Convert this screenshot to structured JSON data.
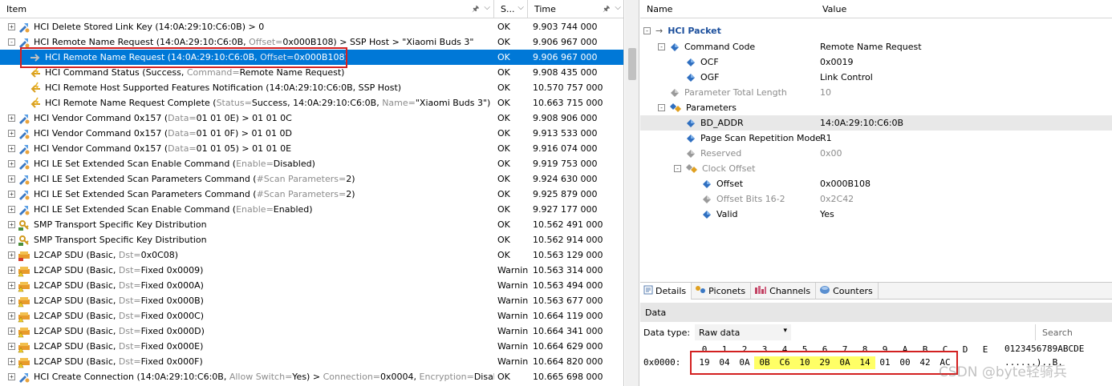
{
  "columns": {
    "item": "Item",
    "status": "S...",
    "time": "Time"
  },
  "rows": [
    {
      "exp": "+",
      "icon": "pkt",
      "text": "HCI Delete Stored Link Key (14:0A:29:10:C6:0B) > 0",
      "status": "OK",
      "time": "9.903 744 000"
    },
    {
      "exp": "-",
      "icon": "pkt",
      "text_a": "HCI Remote Name Request (14:0A:29:10:C6:0B, ",
      "text_g": "Offset=",
      "text_b": "0x000B108) > SSP Host > \"Xiaomi Buds 3\"",
      "status": "OK",
      "time": "9.906 967 000"
    },
    {
      "indent": true,
      "selected": true,
      "icon": "arrow-right",
      "text_a": "HCI Remote Name Request (14:0A:29:10:C6:0B, ",
      "text_g": "Offset=",
      "text_b": "0x000B108)",
      "status": "OK",
      "time": "9.906 967 000"
    },
    {
      "indent": true,
      "icon": "arrow-left-bolt",
      "text_a": "HCI Command Status (Success, ",
      "text_g": "Command=",
      "text_b": "Remote Name Request)",
      "status": "OK",
      "time": "9.908 435 000"
    },
    {
      "indent": true,
      "icon": "arrow-left-bolt",
      "text": "HCI Remote Host Supported Features Notification (14:0A:29:10:C6:0B, SSP Host)",
      "status": "OK",
      "time": "10.570 757 000"
    },
    {
      "indent": true,
      "icon": "arrow-left-bolt",
      "text_a": "HCI Remote Name Request Complete (",
      "text_g": "Status=",
      "text_b": "Success, 14:0A:29:10:C6:0B, ",
      "text_g2": "Name=",
      "text_c": "\"Xiaomi Buds 3\")",
      "status": "OK",
      "time": "10.663 715 000"
    },
    {
      "exp": "+",
      "icon": "pkt",
      "text_a": "HCI Vendor Command 0x157 (",
      "text_g": "Data=",
      "text_b": "01 01 0E) > 01 01 0C",
      "status": "OK",
      "time": "9.908 906 000"
    },
    {
      "exp": "+",
      "icon": "pkt",
      "text_a": "HCI Vendor Command 0x157 (",
      "text_g": "Data=",
      "text_b": "01 01 0F) > 01 01 0D",
      "status": "OK",
      "time": "9.913 533 000"
    },
    {
      "exp": "+",
      "icon": "pkt",
      "text_a": "HCI Vendor Command 0x157 (",
      "text_g": "Data=",
      "text_b": "01 01 05) > 01 01 0E",
      "status": "OK",
      "time": "9.916 074 000"
    },
    {
      "exp": "+",
      "icon": "pkt",
      "text_a": "HCI LE Set Extended Scan Enable Command (",
      "text_g": "Enable=",
      "text_b": "Disabled)",
      "status": "OK",
      "time": "9.919 753 000"
    },
    {
      "exp": "+",
      "icon": "pkt",
      "text_a": "HCI LE Set Extended Scan Parameters Command (",
      "text_g": "#Scan Parameters=",
      "text_b": "2)",
      "status": "OK",
      "time": "9.924 630 000"
    },
    {
      "exp": "+",
      "icon": "pkt",
      "text_a": "HCI LE Set Extended Scan Parameters Command (",
      "text_g": "#Scan Parameters=",
      "text_b": "2)",
      "status": "OK",
      "time": "9.925 879 000"
    },
    {
      "exp": "+",
      "icon": "pkt",
      "text_a": "HCI LE Set Extended Scan Enable Command (",
      "text_g": "Enable=",
      "text_b": "Enabled)",
      "status": "OK",
      "time": "9.927 177 000"
    },
    {
      "exp": "+",
      "icon": "key",
      "text": "SMP Transport Specific Key Distribution",
      "status": "OK",
      "time": "10.562 491 000"
    },
    {
      "exp": "+",
      "icon": "key",
      "text": "SMP Transport Specific Key Distribution",
      "status": "OK",
      "time": "10.562 914 000"
    },
    {
      "exp": "+",
      "icon": "l2cap",
      "text_a": "L2CAP SDU (Basic, ",
      "text_g": "Dst=",
      "text_b": "0x0C08)",
      "status": "OK",
      "time": "10.563 129 000"
    },
    {
      "exp": "+",
      "icon": "l2cap-warn",
      "text_a": "L2CAP SDU (Basic, ",
      "text_g": "Dst=",
      "text_b": "Fixed 0x0009)",
      "status": "Warning",
      "time": "10.563 314 000"
    },
    {
      "exp": "+",
      "icon": "l2cap-warn",
      "text_a": "L2CAP SDU (Basic, ",
      "text_g": "Dst=",
      "text_b": "Fixed 0x000A)",
      "status": "Warning",
      "time": "10.563 494 000"
    },
    {
      "exp": "+",
      "icon": "l2cap-warn",
      "text_a": "L2CAP SDU (Basic, ",
      "text_g": "Dst=",
      "text_b": "Fixed 0x000B)",
      "status": "Warning",
      "time": "10.563 677 000"
    },
    {
      "exp": "+",
      "icon": "l2cap-warn",
      "text_a": "L2CAP SDU (Basic, ",
      "text_g": "Dst=",
      "text_b": "Fixed 0x000C)",
      "status": "Warning",
      "time": "10.664 119 000"
    },
    {
      "exp": "+",
      "icon": "l2cap-warn",
      "text_a": "L2CAP SDU (Basic, ",
      "text_g": "Dst=",
      "text_b": "Fixed 0x000D)",
      "status": "Warning",
      "time": "10.664 341 000"
    },
    {
      "exp": "+",
      "icon": "l2cap-warn",
      "text_a": "L2CAP SDU (Basic, ",
      "text_g": "Dst=",
      "text_b": "Fixed 0x000E)",
      "status": "Warning",
      "time": "10.664 629 000"
    },
    {
      "exp": "+",
      "icon": "l2cap-warn",
      "text_a": "L2CAP SDU (Basic, ",
      "text_g": "Dst=",
      "text_b": "Fixed 0x000F)",
      "status": "Warning",
      "time": "10.664 820 000"
    },
    {
      "exp": "+",
      "icon": "pkt",
      "text_a": "HCI Create Connection (14:0A:29:10:C6:0B, ",
      "text_g": "Allow Switch=",
      "text_b": "Yes) > ",
      "text_g2": "Connection=",
      "text_c": "0x0004, ",
      "text_g3": "Encryption=",
      "text_d": "Disabled",
      "status": "OK",
      "time": "10.665 698 000"
    }
  ],
  "details": {
    "columns": {
      "name": "Name",
      "value": "Value"
    },
    "packet_title": "HCI Packet",
    "props": [
      {
        "level": 1,
        "exp": "-",
        "icon": "diamond-blue",
        "name": "Command Code",
        "value": "Remote Name Request"
      },
      {
        "level": 2,
        "icon": "diamond-blue",
        "name": "OCF",
        "value": "0x0019"
      },
      {
        "level": 2,
        "icon": "diamond-blue",
        "name": "OGF",
        "value": "Link Control"
      },
      {
        "level": 1,
        "icon": "diamond-gray",
        "dim": true,
        "name": "Parameter Total Length",
        "value": "10"
      },
      {
        "level": 1,
        "exp": "-",
        "icon": "multi",
        "name": "Parameters",
        "value": ""
      },
      {
        "level": 2,
        "icon": "diamond-blue",
        "highlight": true,
        "name": "BD_ADDR",
        "value": "14:0A:29:10:C6:0B"
      },
      {
        "level": 2,
        "icon": "diamond-blue",
        "name": "Page Scan Repetition Mode",
        "value": "R1"
      },
      {
        "level": 2,
        "icon": "diamond-gray",
        "dim": true,
        "name": "Reserved",
        "value": "0x00"
      },
      {
        "level": 2,
        "exp": "-",
        "icon": "multi-gray",
        "dim": true,
        "name": "Clock Offset",
        "value": ""
      },
      {
        "level": 3,
        "icon": "diamond-blue",
        "name": "Offset",
        "value": "0x000B108"
      },
      {
        "level": 3,
        "icon": "diamond-gray",
        "dim": true,
        "name": "Offset Bits 16-2",
        "value": "0x2C42"
      },
      {
        "level": 3,
        "icon": "diamond-blue",
        "name": "Valid",
        "value": "Yes"
      }
    ]
  },
  "tabs": [
    {
      "label": "Details",
      "icon": "details-icon",
      "active": true
    },
    {
      "label": "Piconets",
      "icon": "piconets-icon"
    },
    {
      "label": "Channels",
      "icon": "channels-icon"
    },
    {
      "label": "Counters",
      "icon": "counters-icon"
    }
  ],
  "data_panel": {
    "title": "Data",
    "type_label": "Data type:",
    "type_value": "Raw data",
    "search_placeholder": "Search",
    "hex_header": [
      "0",
      "1",
      "2",
      "3",
      "4",
      "5",
      "6",
      "7",
      "8",
      "9",
      "A",
      "B",
      "C",
      "D",
      "E"
    ],
    "ascii_header": "0123456789ABCDE",
    "offset": "0x0000:",
    "bytes": [
      "19",
      "04",
      "0A",
      "0B",
      "C6",
      "10",
      "29",
      "0A",
      "14",
      "01",
      "00",
      "42",
      "AC",
      "",
      ""
    ],
    "highlight_bytes": [
      3,
      4,
      5,
      6,
      7,
      8
    ],
    "ascii": "......)..B.",
    "watermark": "CSDN @byte轻骑兵"
  },
  "colors": {
    "selection": "#0078d7",
    "highlight_box": "#d32020",
    "hex_highlight": "#ffff66",
    "packet_title": "#1c4f9c"
  }
}
